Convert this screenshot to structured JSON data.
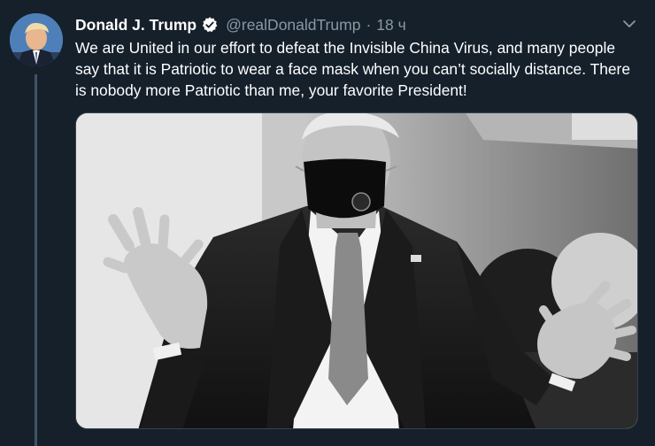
{
  "tweet": {
    "display_name": "Donald J. Trump",
    "handle": "@realDonaldTrump",
    "separator": "·",
    "time": "18 ч",
    "text": "We are United in our effort to defeat the Invisible China Virus, and many people say that it is Patriotic to wear a face mask when you can’t socially distance. There is nobody more Patriotic than me, your favorite President!",
    "verified": true,
    "icons": {
      "verified": "verified-badge-icon",
      "menu": "chevron-down-icon"
    },
    "colors": {
      "background": "#15202b",
      "secondary_text": "#8899a6",
      "thread_line": "#3d5466"
    }
  }
}
